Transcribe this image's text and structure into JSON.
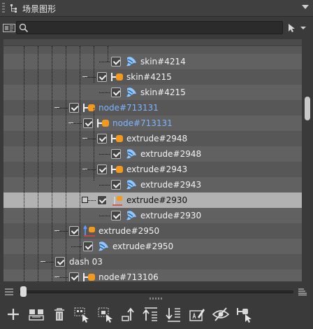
{
  "header": {
    "title": "场景图形"
  },
  "search": {
    "value": "",
    "placeholder": ""
  },
  "tree": {
    "rows": [
      {
        "label": "skin#4214",
        "kind": "skin",
        "checked": true
      },
      {
        "label": "skin#4215",
        "kind": "joint",
        "checked": true
      },
      {
        "label": "skin#4215",
        "kind": "skin",
        "checked": true
      },
      {
        "label": "node#713131",
        "kind": "joint",
        "checked": true,
        "color": "#7fb4ff"
      },
      {
        "label": "node#713131",
        "kind": "joint",
        "checked": true,
        "color": "#7fb4ff"
      },
      {
        "label": "extrude#2948",
        "kind": "joint",
        "checked": true
      },
      {
        "label": "extrude#2948",
        "kind": "skin",
        "checked": true
      },
      {
        "label": "extrude#2943",
        "kind": "joint",
        "checked": true
      },
      {
        "label": "extrude#2943",
        "kind": "skin",
        "checked": true
      },
      {
        "label": "extrude#2930",
        "kind": "transform",
        "checked": true,
        "selected": true
      },
      {
        "label": "extrude#2930",
        "kind": "skin",
        "checked": true
      },
      {
        "label": "extrude#2950",
        "kind": "transform-joint",
        "checked": true
      },
      {
        "label": "extrude#2950",
        "kind": "skin",
        "checked": true
      },
      {
        "label": "dash 03",
        "kind": "none",
        "checked": true
      },
      {
        "label": "node#713106",
        "kind": "joint",
        "checked": true
      }
    ]
  },
  "colors": {
    "accent_orange": "#f39a1e",
    "skin_blue": "#8ec6ff",
    "node_blue_text": "#7fb4ff"
  },
  "toolbar": {
    "icons": [
      "add-icon",
      "group-icon",
      "delete-icon",
      "select-children-icon",
      "select-parent-icon",
      "move-up-icon",
      "move-top-icon",
      "move-bottom-icon",
      "rename-icon",
      "hide-icon",
      "isolate-icon"
    ]
  }
}
